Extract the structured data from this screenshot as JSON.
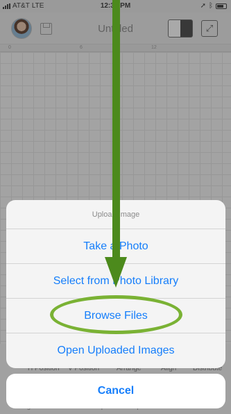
{
  "status_bar": {
    "carrier": "AT&T",
    "network": "LTE",
    "time": "12:37 PM"
  },
  "toolbar": {
    "title": "Untitled",
    "expand_glyph": "⤢"
  },
  "ruler": {
    "ticks": [
      "0",
      "6",
      "12"
    ]
  },
  "bottom_tabs": [
    "H Position",
    "V Position",
    "Arrange",
    "Align",
    "Distribute"
  ],
  "bottom_toolbar": [
    "Image",
    "Text",
    "Shapes",
    "Upload",
    "Actions"
  ],
  "action_sheet": {
    "title": "Upload Image",
    "items": [
      "Take a Photo",
      "Select from Photo Library",
      "Browse Files",
      "Open Uploaded Images"
    ],
    "cancel_label": "Cancel"
  },
  "colors": {
    "ios_blue": "#157efb",
    "annotation_arrow": "#4c8a1c",
    "annotation_ellipse": "#7ab234"
  },
  "icons": {
    "profile": "avatar",
    "save": "save-icon",
    "layers": "layers-toggle-icon",
    "fullscreen": "expand-icon"
  }
}
